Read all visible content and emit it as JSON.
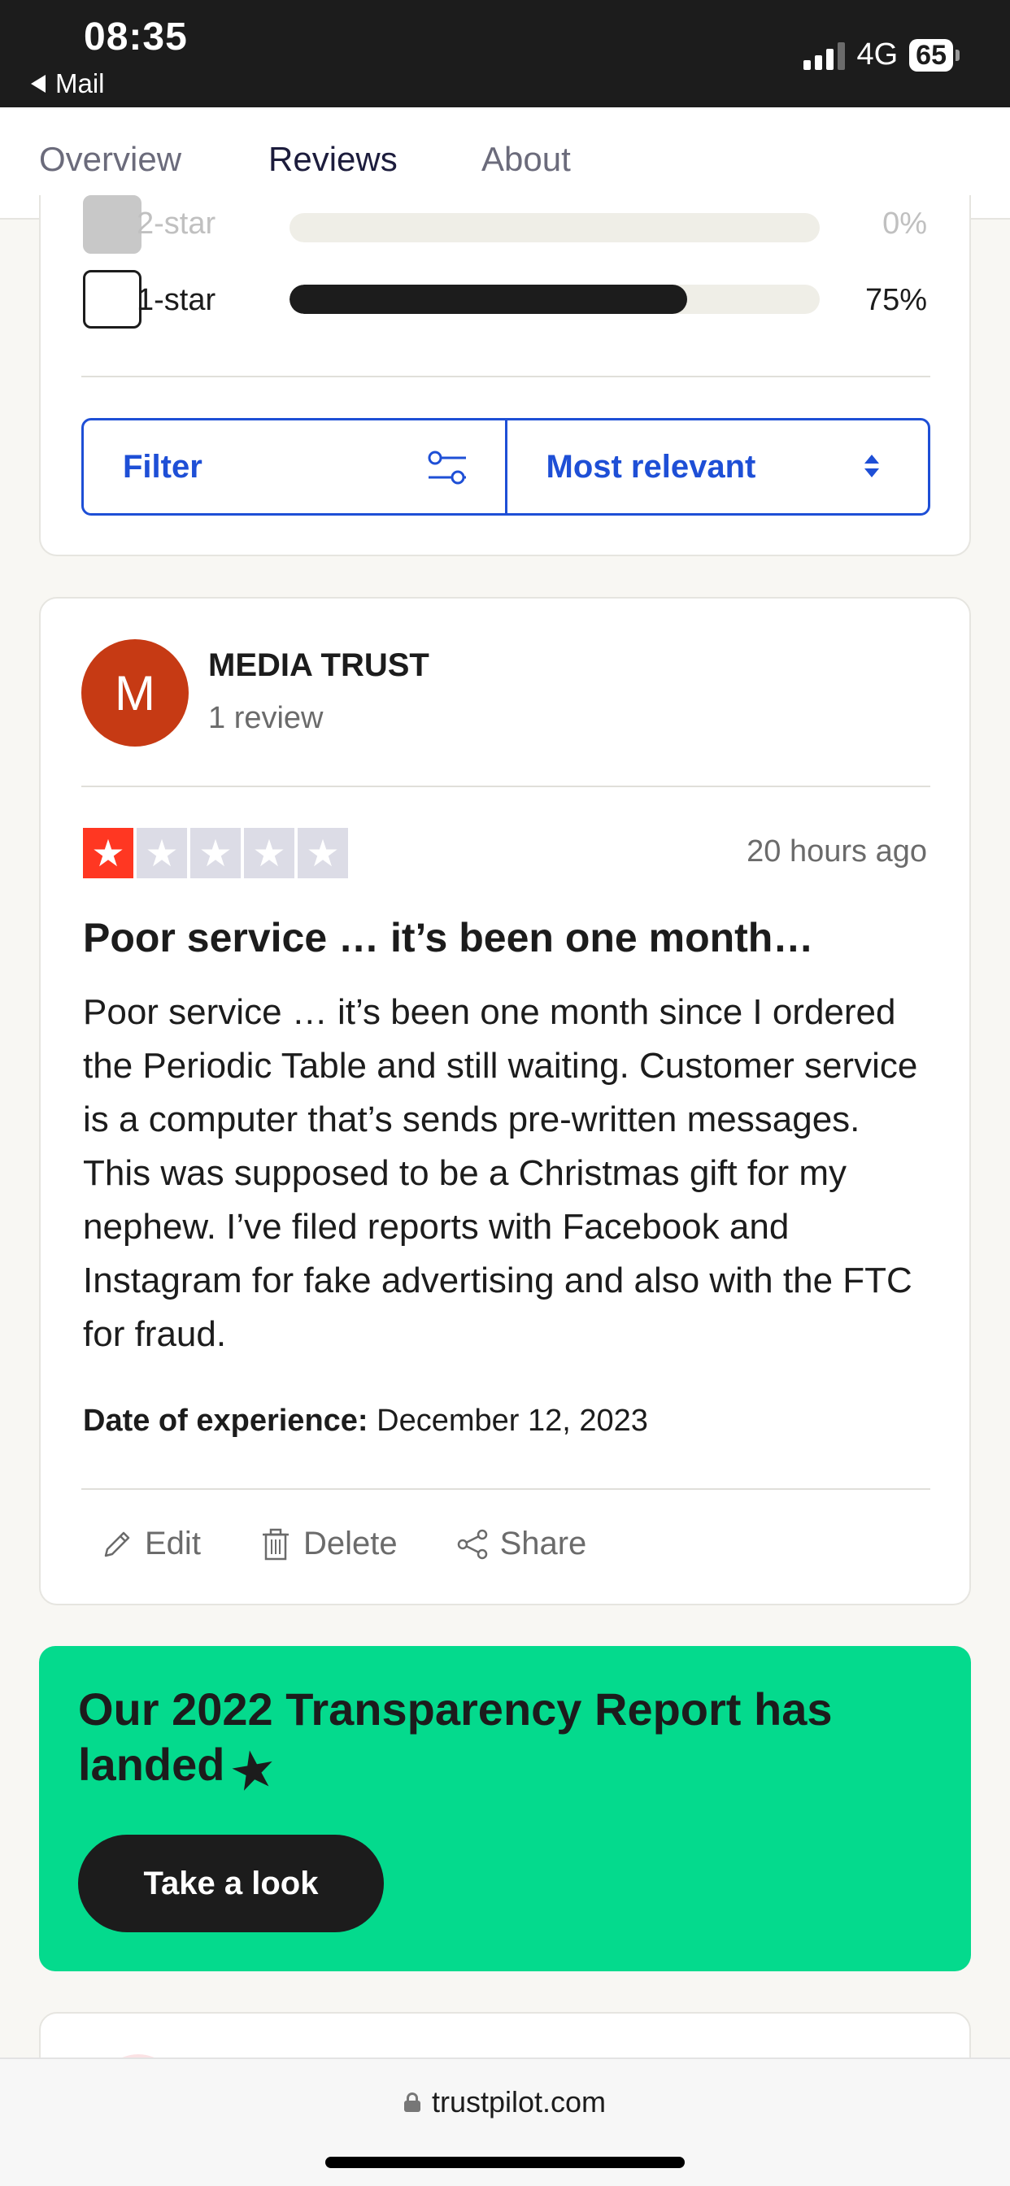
{
  "status_bar": {
    "time": "08:35",
    "back_label": "Mail",
    "network": "4G",
    "battery": "65"
  },
  "tabs": [
    {
      "label": "Overview",
      "active": false
    },
    {
      "label": "Reviews",
      "active": true
    },
    {
      "label": "About",
      "active": false
    }
  ],
  "ratings": [
    {
      "label": "2-star",
      "percent_text": "0%",
      "percent": 0
    },
    {
      "label": "1-star",
      "percent_text": "75%",
      "percent": 75
    }
  ],
  "filter": {
    "filter_label": "Filter",
    "sort_label": "Most relevant"
  },
  "review": {
    "avatar_letter": "M",
    "reviewer_name": "MEDIA TRUST",
    "reviewer_reviews": "1 review",
    "stars": 1,
    "time": "20 hours ago",
    "title": "Poor service … it’s been one month…",
    "body": "Poor service … it’s been one month since I ordered the Periodic Table and still waiting. Customer service is a computer that’s sends pre-written messages. This was supposed to be a Christmas gift for my nephew. I’ve filed reports with Facebook and Instagram for fake advertising and also with the FTC for fraud.",
    "date_label": "Date of experience:",
    "date_value": "December 12, 2023",
    "actions": {
      "edit": "Edit",
      "delete": "Delete",
      "share": "Share"
    }
  },
  "promo": {
    "title": "Our 2022 Transparency Report has landed",
    "button": "Take a look"
  },
  "browser": {
    "url": "trustpilot.com"
  },
  "colors": {
    "accent_blue": "#1e4fd6",
    "star_red": "#ff3722",
    "promo_green": "#04da8d",
    "avatar": "#c63a14"
  }
}
